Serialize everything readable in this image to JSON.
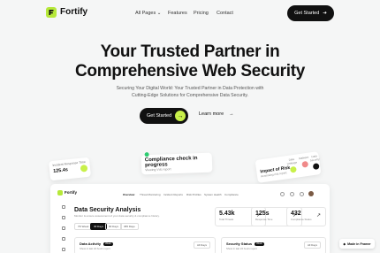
{
  "header": {
    "brand": "Fortify",
    "nav": [
      "All Pages",
      "Features",
      "Pricing",
      "Contact"
    ],
    "cta": "Get Started"
  },
  "hero": {
    "title_line1": "Your Trusted Partner in",
    "title_line2": "Comprehensive Web Security",
    "subtitle_line1": "Securing Your Digital World: Your Trusted Partner in Data Protection with",
    "subtitle_line2": "Cutting-Edge Solutions for Comprehensive Data Security.",
    "primary_cta": "Get Started",
    "secondary_cta": "Learn more"
  },
  "floating": {
    "response_label": "Incident Response Time",
    "response_value": "125.4s",
    "compliance_title": "Compliance check in progress",
    "compliance_sub": "Viewing Vdc report",
    "risk_title": "Impact of Risk",
    "risk_sub": "Accessing risk report",
    "risk_items": [
      "Data Leakage",
      "Malware",
      "Data Security"
    ]
  },
  "dashboard": {
    "brand": "Fortify",
    "nav": [
      "Overview",
      "Threat Monitoring",
      "Incident Reports",
      "Risk Profiles",
      "System Health",
      "Compliance"
    ],
    "title": "Data Security Analysis",
    "desc": "Monitor & ensure assessment of your data security & compliance history.",
    "ranges": [
      "7D Week",
      "30 Days",
      "90 Days",
      "365 Days"
    ],
    "stats": [
      {
        "value": "5.43k",
        "label": "Total Threats"
      },
      {
        "value": "125s",
        "label": "Response Time"
      },
      {
        "value": "432",
        "label": "Compliance Status"
      }
    ],
    "panels": [
      {
        "title": "Data Activity",
        "badge": "Week",
        "sub": "Show in last 24 hours report",
        "select": "All Days"
      },
      {
        "title": "Security Status",
        "badge": "Week",
        "sub": "Show in last 24 hours report",
        "select": "All Days"
      }
    ]
  },
  "badge": {
    "text": "Made in Framer"
  },
  "colors": {
    "accent": "#c8f04a",
    "dark": "#111111"
  }
}
